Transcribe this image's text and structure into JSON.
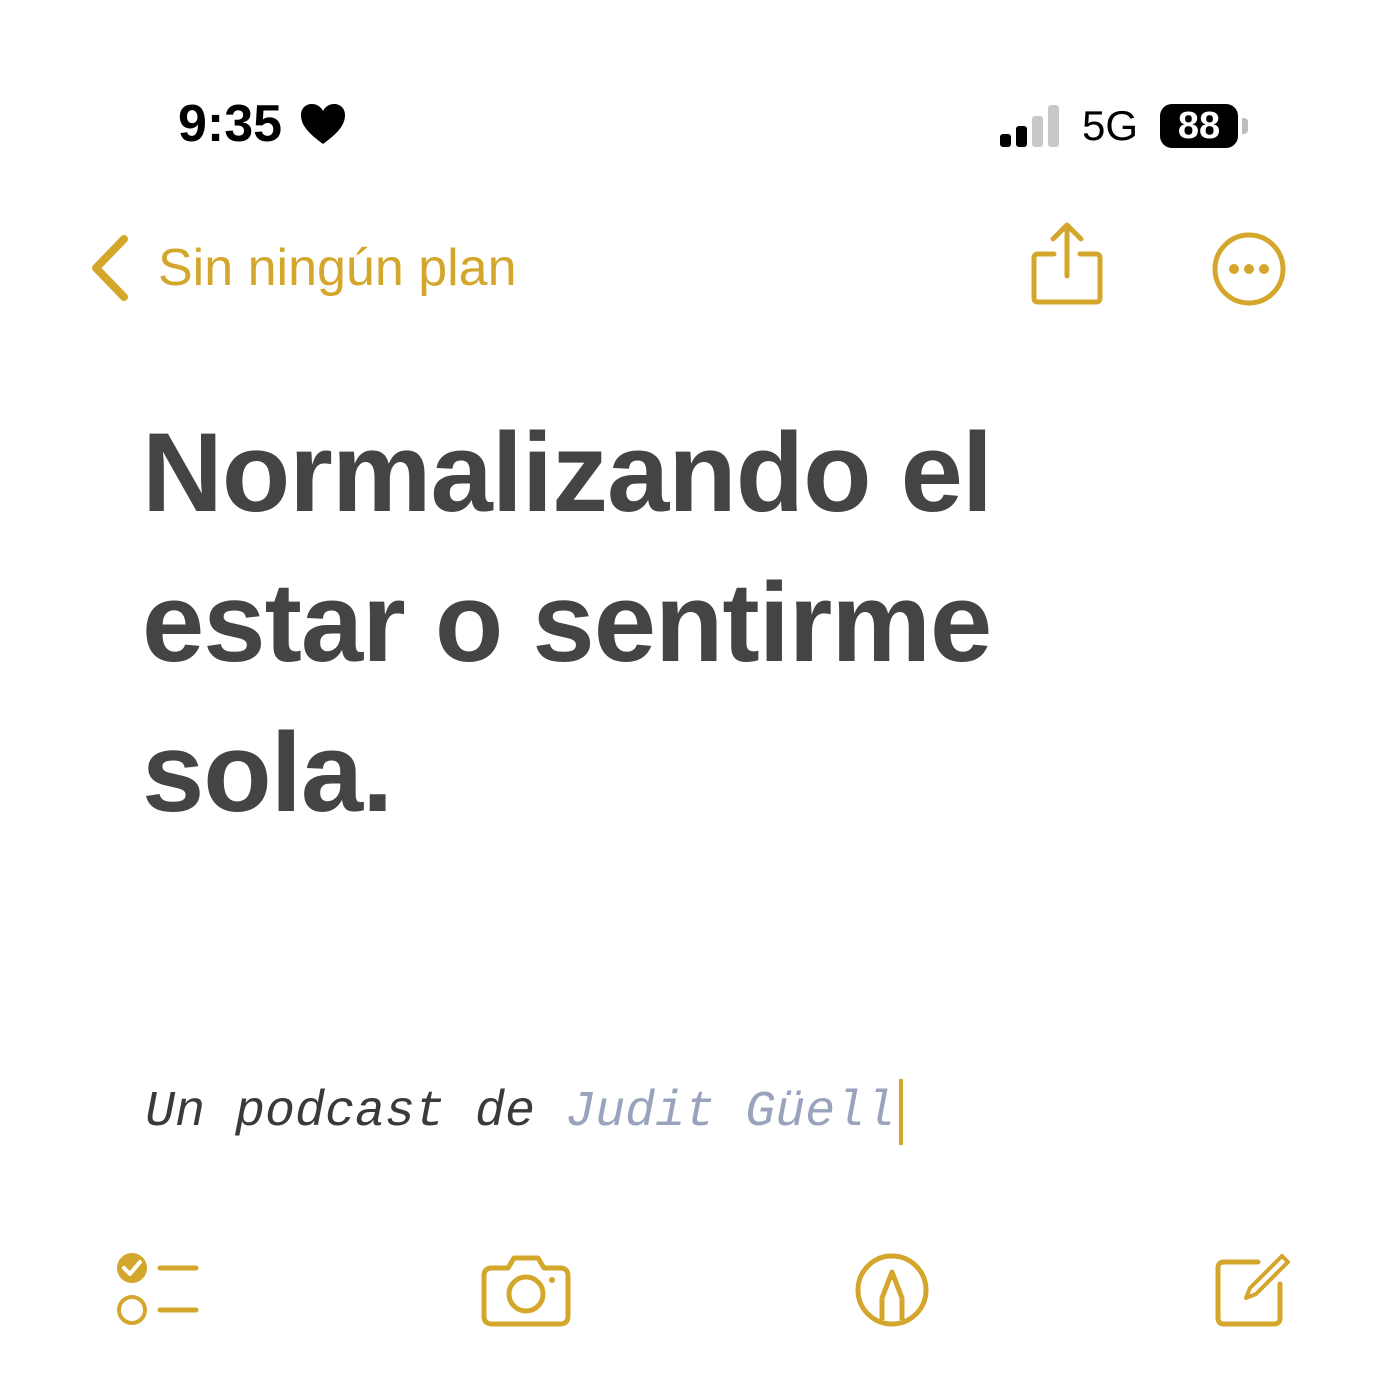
{
  "status_bar": {
    "time": "9:35",
    "network": "5G",
    "battery_level": "88",
    "signal_bars_active": 2,
    "signal_bars_total": 4
  },
  "nav": {
    "back_label": "Sin ningún plan"
  },
  "note": {
    "title_lines": [
      "Normalizando el",
      "estar o sentirme",
      "sola."
    ],
    "subtitle_prefix": "Un podcast de ",
    "subtitle_author": "Judit Güell"
  },
  "icons": {
    "status": [
      "heart-icon",
      "signal-icon",
      "battery-icon"
    ],
    "nav": [
      "chevron-left-icon",
      "share-icon",
      "more-icon"
    ],
    "toolbar": [
      "checklist-icon",
      "camera-icon",
      "markup-icon",
      "compose-icon"
    ]
  },
  "colors": {
    "accent": "#d4a72c",
    "title_text": "#444444",
    "subtitle_author": "#9aa3bd",
    "background": "#ffffff"
  }
}
